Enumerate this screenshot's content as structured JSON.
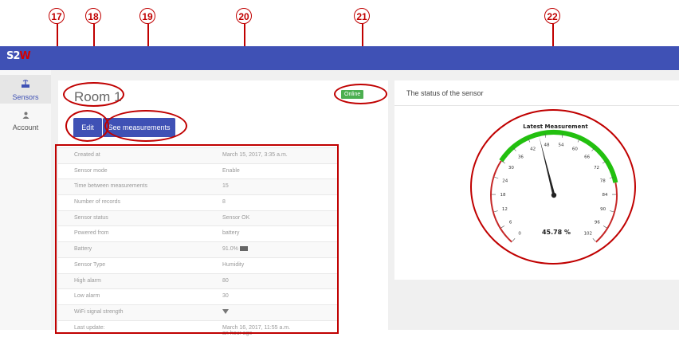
{
  "callouts": [
    {
      "number": "17"
    },
    {
      "number": "18"
    },
    {
      "number": "19"
    },
    {
      "number": "20"
    },
    {
      "number": "21"
    },
    {
      "number": "22"
    }
  ],
  "header": {
    "logo_prefix": "S2",
    "logo_suffix": "W"
  },
  "sidebar": {
    "items": [
      {
        "label": "Sensors",
        "icon": "antenna-icon",
        "active": true
      },
      {
        "label": "Account",
        "icon": "person-icon",
        "active": false
      }
    ]
  },
  "device": {
    "name": "Room 1",
    "status": "Online",
    "edit_label": "Edit",
    "measurements_label": "See measurements"
  },
  "details": [
    {
      "key": "Created at",
      "value": "March 15, 2017, 3:35 a.m."
    },
    {
      "key": "Sensor mode",
      "value": "Enable"
    },
    {
      "key": "Time between measurements",
      "value": "15"
    },
    {
      "key": "Number of records",
      "value": "8"
    },
    {
      "key": "Sensor status",
      "value": "Sensor OK"
    },
    {
      "key": "Powered from",
      "value": "battery"
    },
    {
      "key": "Battery",
      "value": "91.0%"
    },
    {
      "key": "Sensor Type",
      "value": "Humidity"
    },
    {
      "key": "High alarm",
      "value": "80"
    },
    {
      "key": "Low alarm",
      "value": "30"
    },
    {
      "key": "WiFi signal strength",
      "value": ""
    },
    {
      "key": "Last update:",
      "value": "March 16, 2017, 11:55 a.m.",
      "value2": "an hour ago"
    }
  ],
  "status_panel": {
    "title": "The status of the sensor",
    "gauge": {
      "title": "Latest Measurement",
      "value": 45.78,
      "value_text": "45.78 %",
      "min": 0,
      "max": 102,
      "ticks": [
        "0",
        "6",
        "12",
        "18",
        "24",
        "30",
        "36",
        "42",
        "48",
        "54",
        "60",
        "66",
        "72",
        "78",
        "84",
        "90",
        "96",
        "102"
      ],
      "low_alarm": 30,
      "high_alarm": 80,
      "colors": {
        "ok": "#22c00f",
        "alarm": "#c62828",
        "needle": "#222222"
      }
    }
  },
  "colors": {
    "primary": "#3f51b5",
    "online": "#4caf50",
    "annotation": "#c00000"
  }
}
